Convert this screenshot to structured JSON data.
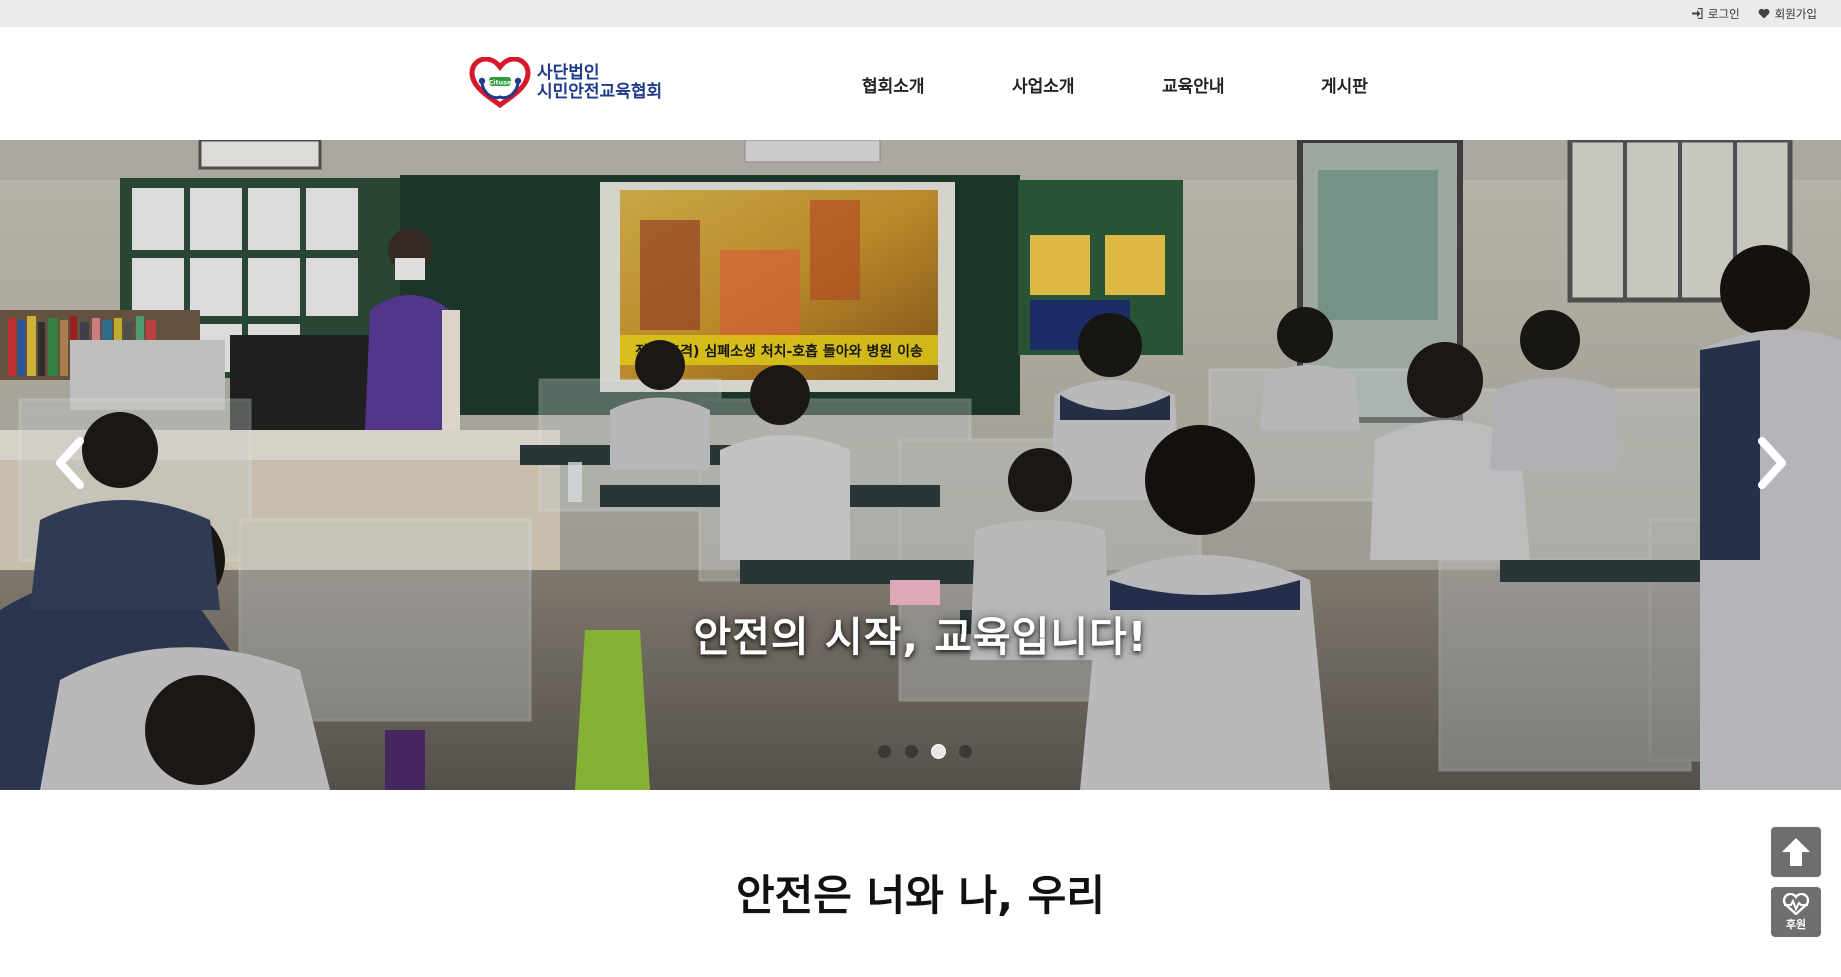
{
  "topbar": {
    "login_label": "로그인",
    "login_icon": "sign-in-icon",
    "signup_label": "회원가입",
    "signup_icon": "heart-icon"
  },
  "logo": {
    "badge_text": "Cituse",
    "line1": "사단법인",
    "line2": "시민안전교육협회",
    "brand_color": "#1f3a8a",
    "accent_color": "#d7192b"
  },
  "nav": {
    "items": [
      {
        "label": "협회소개"
      },
      {
        "label": "사업소개"
      },
      {
        "label": "교육안내"
      },
      {
        "label": "게시판"
      }
    ]
  },
  "hero": {
    "caption": "안전의 시작, 교육입니다!",
    "screen_text": "전기(충격) 심폐소생 처치-호흡 돌아와 병원 이송",
    "slide_count": 4,
    "active_slide": 3
  },
  "section": {
    "headline": "안전은 너와 나, 우리"
  },
  "floating": {
    "top_icon": "arrow-up-icon",
    "donate_label": "후원",
    "donate_icon": "heartbeat-icon"
  }
}
